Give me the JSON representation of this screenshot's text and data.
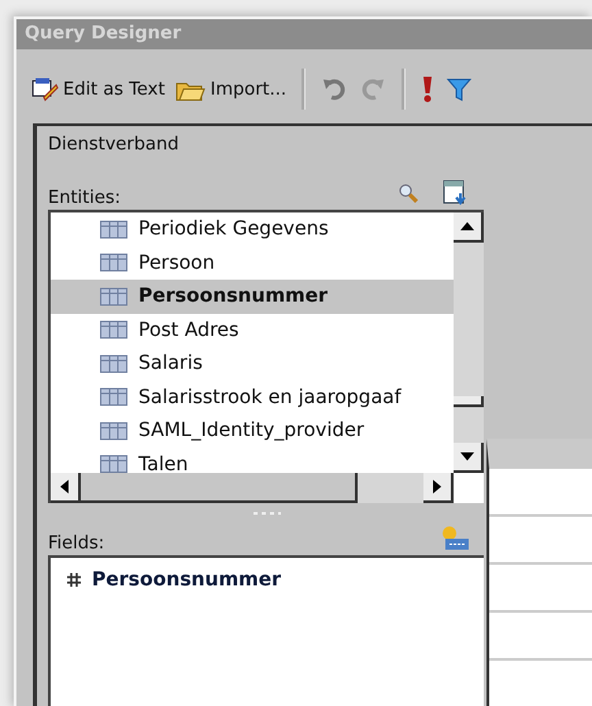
{
  "window": {
    "title": "Query Designer"
  },
  "toolbar": [
    {
      "kind": "edit-text",
      "label": "Edit as Text"
    },
    {
      "kind": "import",
      "label": "Import..."
    },
    {
      "kind": "separator"
    },
    {
      "kind": "undo"
    },
    {
      "kind": "redo"
    },
    {
      "kind": "separator"
    },
    {
      "kind": "run"
    },
    {
      "kind": "filter"
    }
  ],
  "dataset": {
    "name": "Dienstverband"
  },
  "entities": {
    "label": "Entities:",
    "items": [
      {
        "name": "Periodiek Gegevens",
        "selected": false
      },
      {
        "name": "Persoon",
        "selected": false
      },
      {
        "name": "Persoonsnummer",
        "selected": true
      },
      {
        "name": "Post Adres",
        "selected": false
      },
      {
        "name": "Salaris",
        "selected": false
      },
      {
        "name": "Salarisstrook en jaaropgaaf",
        "selected": false
      },
      {
        "name": "SAML_Identity_provider",
        "selected": false
      },
      {
        "name": "Talen",
        "selected": false
      }
    ]
  },
  "fields": {
    "label": "Fields:",
    "items": [
      {
        "name": "Persoonsnummer"
      }
    ]
  }
}
